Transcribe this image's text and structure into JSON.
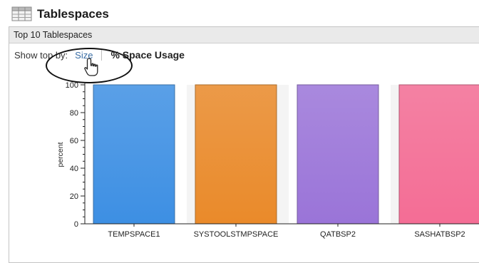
{
  "widget": {
    "title": "Tablespaces",
    "icon": "table-grid-icon",
    "panel_header": "Top 10 Tablespaces"
  },
  "toolbar": {
    "show_label": "Show top by:",
    "options": [
      "Size",
      "% Space Usage"
    ],
    "selected": "% Space Usage"
  },
  "colors": {
    "tempspace1": "#3d8fe3",
    "systoolstmpspace": "#ea8a2a",
    "qatbsp2": "#9a74d8",
    "sashatbsp2": "#f46d95"
  },
  "chart_data": {
    "type": "bar",
    "categories": [
      "TEMPSPACE1",
      "SYSTOOLSTMPSPACE",
      "QATBSP2",
      "SASHATBSP2"
    ],
    "values": [
      100,
      100,
      100,
      100
    ],
    "ylabel": "percent",
    "ylim": [
      0,
      100
    ],
    "yticks": [
      0,
      20,
      40,
      60,
      80,
      100
    ],
    "grid": false,
    "legend": "none"
  }
}
